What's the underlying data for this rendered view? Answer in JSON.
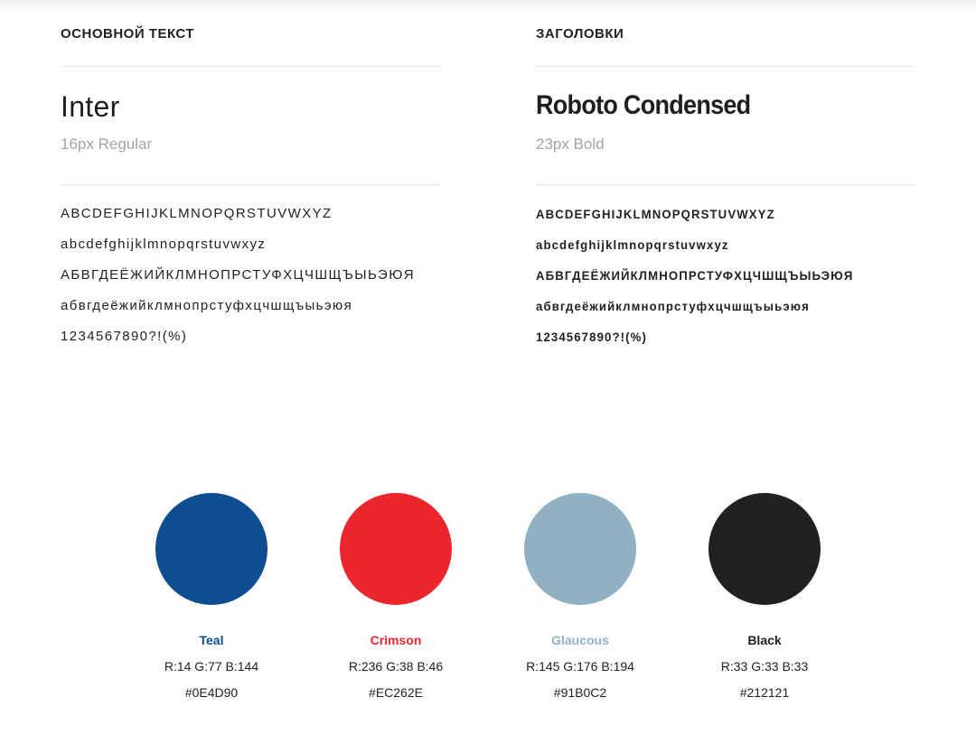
{
  "body_text": {
    "label": "ОСНОВНОЙ ТЕКСТ",
    "font_name": "Inter",
    "font_spec": "16px Regular",
    "glyph_lines": [
      "ABCDEFGHIJKLMNOPQRSTUVWXYZ",
      "abcdefghijklmnopqrstuvwxyz",
      "АБВГДЕЁЖИЙКЛМНОПРСТУФХЦЧШЩЪЫЬЭЮЯ",
      "абвгдеёжийклмнопрстуфхцчшщъыьэюя",
      "1234567890?!(%)"
    ]
  },
  "headings": {
    "label": "ЗАГОЛОВКИ",
    "font_name": "Roboto Condensed",
    "font_spec": "23px Bold",
    "glyph_lines": [
      "ABCDEFGHIJKLMNOPQRSTUVWXYZ",
      "abcdefghijklmnopqrstuvwxyz",
      "АБВГДЕЁЖИЙКЛМНОПРСТУФХЦЧШЩЪЫЬЭЮЯ",
      "абвгдеёжийклмнопрстуфхцчшщъыьэюя",
      "1234567890?!(%)"
    ]
  },
  "palette": [
    {
      "name": "Teal",
      "rgb": "R:14 G:77 B:144",
      "hex": "#0E4D90",
      "color": "#0E4D90"
    },
    {
      "name": "Crimson",
      "rgb": "R:236 G:38 B:46",
      "hex": "#EC262E",
      "color": "#EC262E"
    },
    {
      "name": "Glaucous",
      "rgb": "R:145 G:176 B:194",
      "hex": "#91B0C2",
      "color": "#91B0C2"
    },
    {
      "name": "Black",
      "rgb": "R:33 G:33 B:33",
      "hex": "#212121",
      "color": "#212121"
    }
  ]
}
